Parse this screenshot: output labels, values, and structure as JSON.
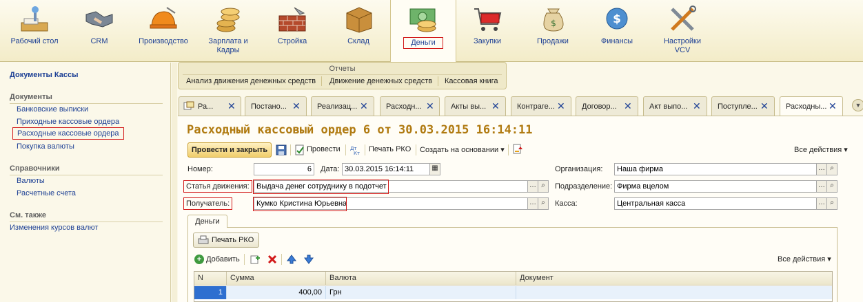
{
  "sections": [
    {
      "label": "Рабочий стол",
      "icon": "desktop-icon"
    },
    {
      "label": "CRM",
      "icon": "handshake-icon"
    },
    {
      "label": "Производство",
      "icon": "hardhat-icon"
    },
    {
      "label": "Зарплата и Кадры",
      "icon": "coins-icon"
    },
    {
      "label": "Стройка",
      "icon": "bricks-icon"
    },
    {
      "label": "Склад",
      "icon": "box-icon"
    },
    {
      "label": "Деньги",
      "icon": "money-icon"
    },
    {
      "label": "Закупки",
      "icon": "cart-icon"
    },
    {
      "label": "Продажи",
      "icon": "money-bag-icon"
    },
    {
      "label": "Финансы",
      "icon": "dollar-icon"
    },
    {
      "label": "Настройки VCV",
      "icon": "tools-icon"
    }
  ],
  "left_panel": {
    "title": "Документы Кассы",
    "groups": [
      {
        "title": "Документы",
        "items": [
          "Банковские выписки",
          "Приходные кассовые ордера",
          "Расходные кассовые ордера",
          "Покупка валюты"
        ]
      },
      {
        "title": "Справочники",
        "items": [
          "Валюты",
          "Расчетные счета"
        ]
      },
      {
        "title": "См. также",
        "items": [
          "Изменения курсов валют"
        ]
      }
    ]
  },
  "reports": {
    "title": "Отчеты",
    "items": [
      "Анализ движения денежных средств",
      "Движение денежных средств",
      "Кассовая книга"
    ]
  },
  "tabs": [
    "Ра...",
    "Постано...",
    "Реализац...",
    "Расходн...",
    "Акты вы...",
    "Контраге...",
    "Договор...",
    "Акт выпо...",
    "Поступле...",
    "Расходны..."
  ],
  "document": {
    "title": "Расходный кассовый ордер 6 от 30.03.2015 16:14:11",
    "toolbar": {
      "post_close": "Провести и закрыть",
      "post": "Провести",
      "print": "Печать РКО",
      "create_based": "Создать на основании",
      "all_actions": "Все действия"
    },
    "fields": {
      "number_label": "Номер:",
      "number": "6",
      "date_label": "Дата:",
      "date": "30.03.2015 16:14:11",
      "article_label": "Статья движения:",
      "article": "Выдача денег сотруднику в подотчет",
      "recipient_label": "Получатель:",
      "recipient": "Кумко Кристина Юрьевна",
      "org_label": "Организация:",
      "org": "Наша фирма",
      "division_label": "Подразделение:",
      "division": "Фирма вцелом",
      "cashbox_label": "Касса:",
      "cashbox": "Центральная касса"
    },
    "money_tab": {
      "tab_label": "Деньги",
      "print": "Печать РКО",
      "add": "Добавить",
      "all_actions": "Все действия",
      "columns": [
        "N",
        "Сумма",
        "Валюта",
        "Документ"
      ],
      "rows": [
        {
          "n": "1",
          "sum": "400,00",
          "currency": "Грн",
          "doc": ""
        }
      ]
    }
  },
  "colors": {
    "accent": "#d21a1a",
    "link": "#1c3f94",
    "title": "#b07a10"
  }
}
